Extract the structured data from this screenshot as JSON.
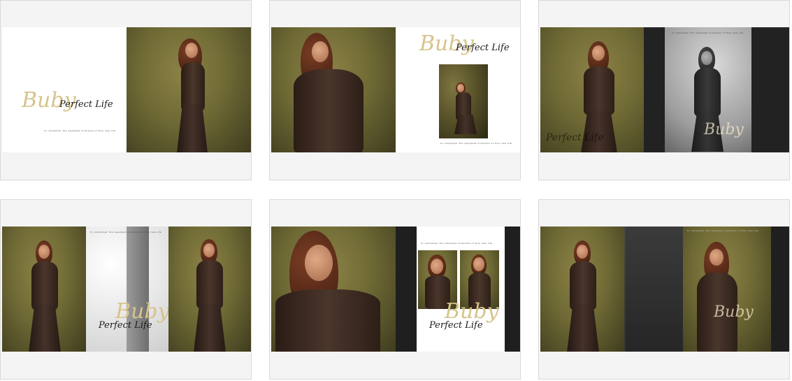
{
  "albums": [
    {
      "logo_script": "Buby",
      "logo_text": "Perfect Life",
      "caption": "to remember the sweetest moments of this new life"
    },
    {
      "logo_script": "Buby",
      "logo_text": "Perfect Life",
      "caption": "to remember the sweetest moments of this new life"
    },
    {
      "watermark_left": "Perfect Life",
      "watermark_right": "Buby",
      "caption": "to remember the sweetest moments of this new life"
    },
    {
      "caption": "to remember the sweetest moments of this new life",
      "logo_script": "Buby",
      "logo_text": "Perfect Life"
    },
    {
      "caption": "to remember the sweetest moments of this new life",
      "logo_script": "Buby",
      "logo_text": "Perfect Life"
    },
    {
      "caption": "to remember the sweetest moments of this new life",
      "watermark_right": "Buby"
    }
  ]
}
